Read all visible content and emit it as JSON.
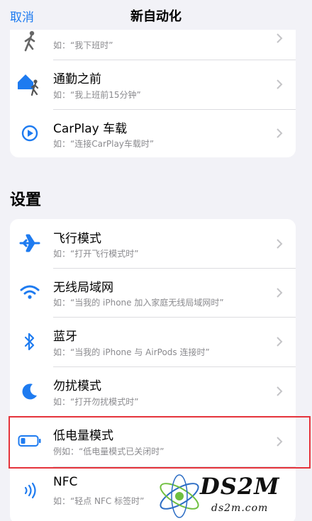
{
  "nav": {
    "cancel": "取消",
    "title": "新自动化"
  },
  "travel": {
    "items": [
      {
        "title": "",
        "sub": "如：“我下班时”",
        "icon": "person-walking-icon"
      },
      {
        "title": "通勤之前",
        "sub": "如：“我上班前15分钟”",
        "icon": "home-commute-icon"
      },
      {
        "title": "CarPlay 车载",
        "sub": "如：“连接CarPlay车载时”",
        "icon": "carplay-icon"
      }
    ]
  },
  "settings": {
    "header": "设置",
    "items": [
      {
        "title": "飞行模式",
        "sub": "如：“打开飞行模式时”",
        "icon": "airplane-icon"
      },
      {
        "title": "无线局域网",
        "sub": "如：“当我的 iPhone 加入家庭无线局域网时”",
        "icon": "wifi-icon"
      },
      {
        "title": "蓝牙",
        "sub": "如：“当我的 iPhone 与 AirPods 连接时”",
        "icon": "bluetooth-icon"
      },
      {
        "title": "勿扰模式",
        "sub": "如：“打开勿扰模式时”",
        "icon": "moon-icon"
      },
      {
        "title": "低电量模式",
        "sub": "例如：“低电量模式已关闭时”",
        "icon": "battery-icon"
      },
      {
        "title": "NFC",
        "sub": "如：“轻点 NFC 标签时”",
        "icon": "nfc-icon"
      }
    ]
  },
  "watermark": {
    "brand": "DS2M",
    "sub": "ds2m.com"
  },
  "colors": {
    "accent": "#1e7bf0",
    "highlight": "#e5333b",
    "background": "#f2f2f7"
  }
}
